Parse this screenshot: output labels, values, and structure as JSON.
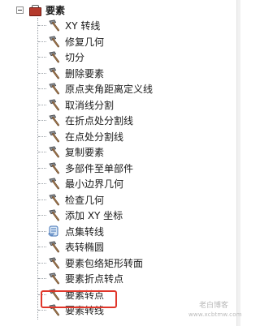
{
  "toolset": {
    "label": "要素",
    "expanded": true,
    "expander_symbol": "minus"
  },
  "tools": [
    {
      "label": "XY 转线",
      "icon": "hammer-icon"
    },
    {
      "label": "修复几何",
      "icon": "hammer-icon"
    },
    {
      "label": "切分",
      "icon": "hammer-icon"
    },
    {
      "label": "删除要素",
      "icon": "hammer-icon"
    },
    {
      "label": "原点夹角距离定义线",
      "icon": "hammer-icon"
    },
    {
      "label": "取消线分割",
      "icon": "hammer-icon"
    },
    {
      "label": "在折点处分割线",
      "icon": "hammer-icon"
    },
    {
      "label": "在点处分割线",
      "icon": "hammer-icon"
    },
    {
      "label": "复制要素",
      "icon": "hammer-icon"
    },
    {
      "label": "多部件至单部件",
      "icon": "hammer-icon"
    },
    {
      "label": "最小边界几何",
      "icon": "hammer-icon"
    },
    {
      "label": "检查几何",
      "icon": "hammer-icon"
    },
    {
      "label": "添加 XY 坐标",
      "icon": "hammer-icon"
    },
    {
      "label": "点集转线",
      "icon": "script-icon"
    },
    {
      "label": "表转椭圆",
      "icon": "hammer-icon"
    },
    {
      "label": "要素包络矩形转面",
      "icon": "hammer-icon"
    },
    {
      "label": "要素折点转点",
      "icon": "hammer-icon"
    },
    {
      "label": "要素转点",
      "icon": "hammer-icon",
      "highlighted": true
    },
    {
      "label": "要素转线",
      "icon": "hammer-icon"
    }
  ],
  "highlight_color": "#e0362a",
  "watermark": {
    "line1": "老白博客",
    "line2": "www.xcbtmw.com"
  }
}
